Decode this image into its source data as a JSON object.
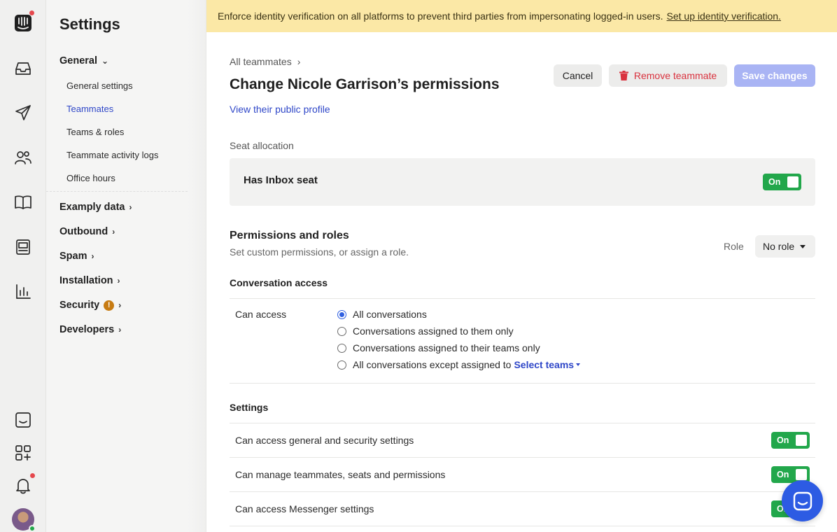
{
  "banner": {
    "text": "Enforce identity verification on all platforms to prevent third parties from impersonating logged-in users.",
    "link": "Set up identity verification."
  },
  "rail": {
    "icons": [
      "logo-icon",
      "inbox-icon",
      "outbound-icon",
      "contacts-icon",
      "knowledge-icon",
      "reports-dashboard-icon",
      "analytics-icon",
      "messenger-preview-icon",
      "apps-icon",
      "notifications-icon"
    ]
  },
  "nav": {
    "title": "Settings",
    "general": "General",
    "items": [
      "General settings",
      "Teammates",
      "Teams & roles",
      "Teammate activity logs",
      "Office hours"
    ],
    "groups": [
      "Examply data",
      "Outbound",
      "Spam",
      "Installation",
      "Security",
      "Developers"
    ],
    "security_warning": "!"
  },
  "header": {
    "breadcrumb": "All teammates",
    "title": "Change Nicole Garrison’s permissions",
    "profile_link": "View their public profile",
    "cancel": "Cancel",
    "remove": "Remove teammate",
    "save": "Save changes"
  },
  "seat": {
    "section_label": "Seat allocation",
    "label": "Has Inbox seat",
    "toggle": "On"
  },
  "permissions": {
    "title": "Permissions and roles",
    "subtitle": "Set custom permissions, or assign a role.",
    "role_label": "Role",
    "role_value": "No role"
  },
  "conversation_access": {
    "title": "Conversation access",
    "can_access": "Can access",
    "options": [
      "All conversations",
      "Conversations assigned to them only",
      "Conversations assigned to their teams only",
      "All conversations except assigned to"
    ],
    "select_teams": "Select teams",
    "selected_index": 0
  },
  "settings": {
    "title": "Settings",
    "rows": [
      {
        "label": "Can access general and security settings",
        "toggle": "On"
      },
      {
        "label": "Can manage teammates, seats and permissions",
        "toggle": "On"
      },
      {
        "label": "Can access Messenger settings",
        "toggle": "On"
      }
    ]
  }
}
